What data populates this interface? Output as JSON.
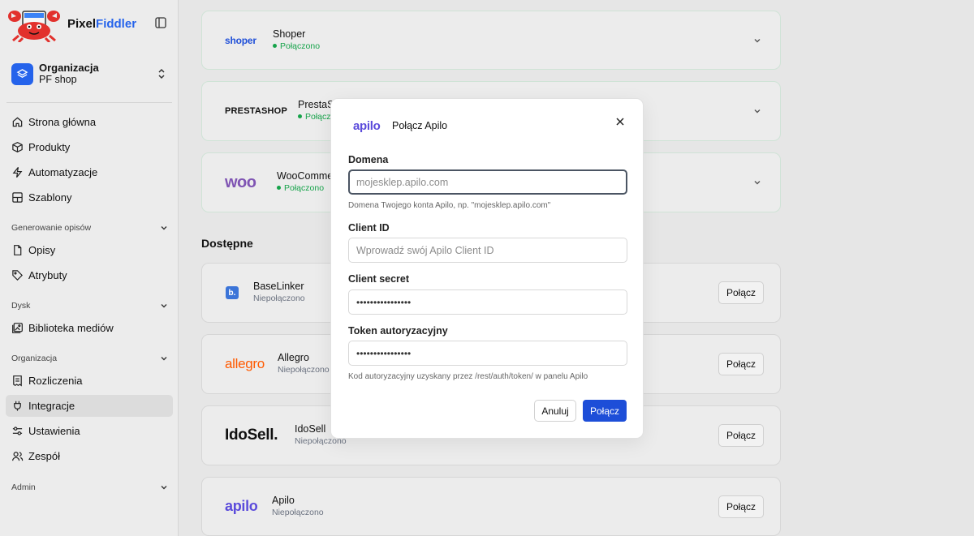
{
  "brand": {
    "name_part1": "Pixel",
    "name_part2": "Fiddler"
  },
  "organization": {
    "title": "Organizacja",
    "name": "PF shop"
  },
  "nav": {
    "home": "Strona główna",
    "products": "Produkty",
    "automations": "Automatyzacje",
    "templates": "Szablony",
    "section_descriptions": "Generowanie opisów",
    "descriptions": "Opisy",
    "attributes": "Atrybuty",
    "section_disk": "Dysk",
    "media_library": "Biblioteka mediów",
    "section_organization": "Organizacja",
    "billing": "Rozliczenia",
    "integrations": "Integracje",
    "settings": "Ustawienia",
    "team": "Zespół",
    "section_admin": "Admin"
  },
  "connected": [
    {
      "logo": "shoper",
      "name": "Shoper",
      "status": "Połączono"
    },
    {
      "logo": "PRESTASHOP",
      "name": "PrestaShop",
      "status": "Połączono"
    },
    {
      "logo": "woo",
      "name": "WooCommerce",
      "status": "Połączono"
    }
  ],
  "available_title": "Dostępne",
  "available": [
    {
      "logo": "b.",
      "name": "BaseLinker",
      "status": "Niepołączono",
      "button": "Połącz"
    },
    {
      "logo": "allegro",
      "name": "Allegro",
      "status": "Niepołączono",
      "button": "Połącz"
    },
    {
      "logo": "IdoSell.",
      "name": "IdoSell",
      "status": "Niepołączono",
      "button": "Połącz"
    },
    {
      "logo": "apilo",
      "name": "Apilo",
      "status": "Niepołączono",
      "button": "Połącz"
    }
  ],
  "modal": {
    "logo": "apilo",
    "title": "Połącz Apilo",
    "domain_label": "Domena",
    "domain_placeholder": "mojesklep.apilo.com",
    "domain_help": "Domena Twojego konta Apilo, np. \"mojesklep.apilo.com\"",
    "client_id_label": "Client ID",
    "client_id_placeholder": "Wprowadź swój Apilo Client ID",
    "client_secret_label": "Client secret",
    "client_secret_value": "••••••••••••••••",
    "token_label": "Token autoryzacyjny",
    "token_value": "••••••••••••••••",
    "token_help": "Kod autoryzacyjny uzyskany przez /rest/auth/token/ w panelu Apilo",
    "cancel": "Anuluj",
    "submit": "Połącz"
  },
  "colors": {
    "accent": "#2563eb",
    "primary_button": "#1d4ed8",
    "connected_green": "#16a34a",
    "allegro_orange": "#ff5a00",
    "woo_purple": "#7f54b3",
    "apilo_purple": "#5b4bdb"
  },
  "icons": [
    "sidebar-toggle-icon",
    "stack-icon",
    "up-down-chevron-icon",
    "home-icon",
    "box-icon",
    "zap-icon",
    "layout-icon",
    "file-icon",
    "tag-icon",
    "image-icon",
    "receipt-icon",
    "plug-icon",
    "sliders-icon",
    "users-icon",
    "chevron-down-icon",
    "close-icon"
  ]
}
